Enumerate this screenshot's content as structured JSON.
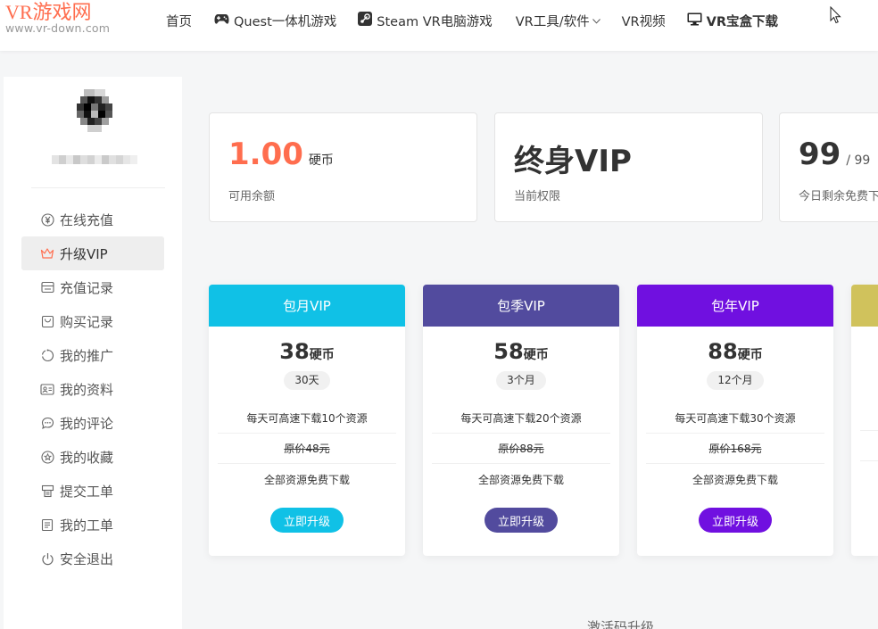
{
  "header": {
    "logo_title": "VR游戏网",
    "logo_sub": "www.vr-down.com",
    "nav": [
      {
        "label": "首页",
        "icon": "none"
      },
      {
        "label": "Quest一体机游戏",
        "icon": "gamepad-icon"
      },
      {
        "label": "Steam VR电脑游戏",
        "icon": "steam-icon"
      },
      {
        "label": "VR工具/软件",
        "icon": "chevron-down-icon"
      },
      {
        "label": "VR视频",
        "icon": "none"
      },
      {
        "label": "VR宝盒下载",
        "icon": "monitor-icon"
      }
    ]
  },
  "sidebar": {
    "items": [
      {
        "label": "在线充值",
        "icon": "yen-circle-icon"
      },
      {
        "label": "升级VIP",
        "icon": "crown-icon"
      },
      {
        "label": "充值记录",
        "icon": "wallet-icon"
      },
      {
        "label": "购买记录",
        "icon": "bag-icon"
      },
      {
        "label": "我的推广",
        "icon": "share-circle-icon"
      },
      {
        "label": "我的资料",
        "icon": "id-card-icon"
      },
      {
        "label": "我的评论",
        "icon": "comment-icon"
      },
      {
        "label": "我的收藏",
        "icon": "star-icon"
      },
      {
        "label": "提交工单",
        "icon": "printer-icon"
      },
      {
        "label": "我的工单",
        "icon": "document-icon"
      },
      {
        "label": "安全退出",
        "icon": "power-icon"
      }
    ],
    "active_index": 1
  },
  "stats": {
    "balance": {
      "value": "1.00",
      "unit": "硬币",
      "label": "可用余额"
    },
    "level": {
      "value": "终身VIP",
      "label": "当前权限"
    },
    "downloads": {
      "value": "99",
      "total": "/ 99",
      "label": "今日剩余免费下载次数"
    }
  },
  "vip_plans": [
    {
      "title": "包月VIP",
      "price": "38",
      "unit": "硬币",
      "duration": "30天",
      "feature": "每天可高速下载10个资源",
      "original": "原价48元",
      "benefit": "全部资源免费下载",
      "button": "立即升级",
      "color": "#10c1e6"
    },
    {
      "title": "包季VIP",
      "price": "58",
      "unit": "硬币",
      "duration": "3个月",
      "feature": "每天可高速下载20个资源",
      "original": "原价88元",
      "benefit": "全部资源免费下载",
      "button": "立即升级",
      "color": "#524b9e"
    },
    {
      "title": "包年VIP",
      "price": "88",
      "unit": "硬币",
      "duration": "12个月",
      "feature": "每天可高速下载30个资源",
      "original": "原价168元",
      "benefit": "全部资源免费下载",
      "button": "立即升级",
      "color": "#7010e0"
    },
    {
      "title": "",
      "price": "",
      "unit": "",
      "duration": "",
      "feature": "",
      "original": "",
      "benefit": "",
      "button": "",
      "color": "#d0c25c"
    }
  ],
  "activate_label": "激活码升级",
  "colors": {
    "accent": "#ff6d4e",
    "text": "#333333"
  }
}
